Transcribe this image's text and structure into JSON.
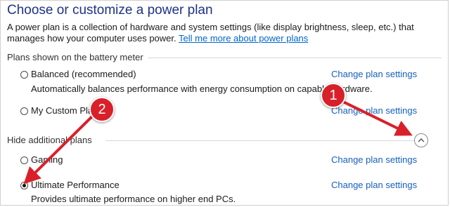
{
  "title": "Choose or customize a power plan",
  "description": {
    "text": "A power plan is a collection of hardware and system settings (like display brightness, sleep, etc.) that manages how your computer uses power.",
    "link": "Tell me more about power plans"
  },
  "sections": {
    "battery_meter": "Plans shown on the battery meter",
    "hidden": "Hide additional plans"
  },
  "plans": [
    {
      "label": "Balanced (recommended)",
      "description": "Automatically balances performance with energy consumption on capable hardware.",
      "selected": false,
      "link": "Change plan settings"
    },
    {
      "label": "My Custom Plan",
      "selected": false,
      "link": "Change plan settings"
    },
    {
      "label": "Gaming",
      "selected": false,
      "link": "Change plan settings"
    },
    {
      "label": "Ultimate Performance",
      "description": "Provides ultimate performance on higher end PCs.",
      "selected": true,
      "link": "Change plan settings"
    }
  ],
  "annotations": [
    {
      "label": "1"
    },
    {
      "label": "2"
    }
  ],
  "colors": {
    "title": "#1e3287",
    "link": "#1560bd",
    "annotation": "#d9202a"
  },
  "icons": {
    "collapse": "chevron-up-icon"
  }
}
